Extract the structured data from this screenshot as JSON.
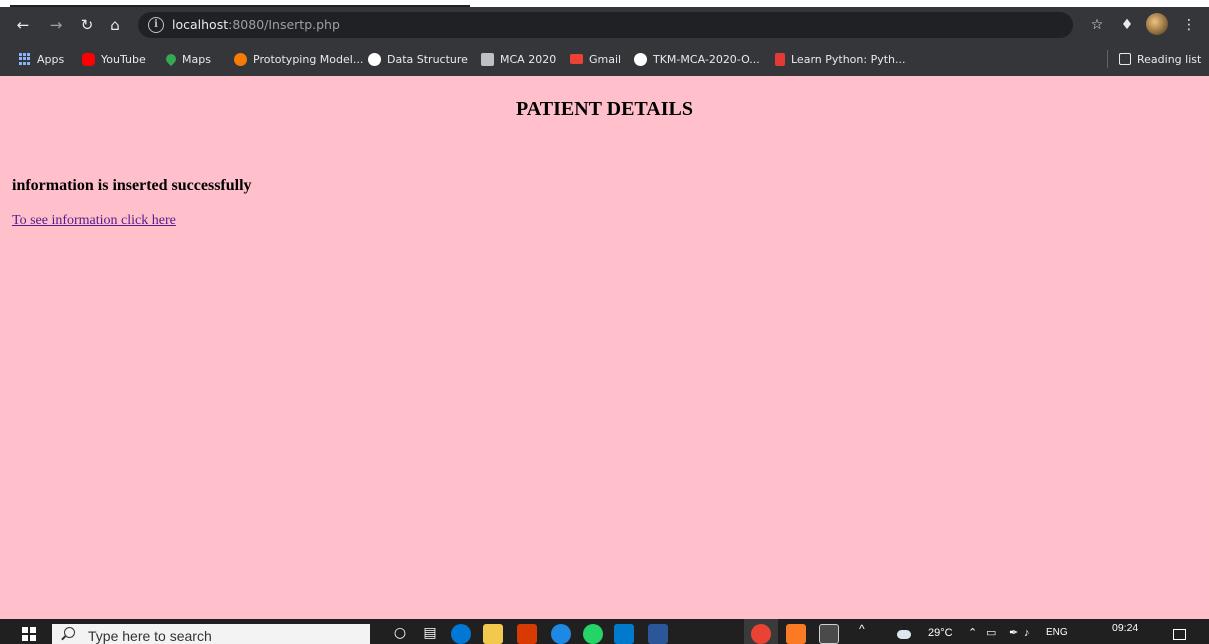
{
  "browser": {
    "url_host": "localhost",
    "url_rest": ":8080/Insertp.php",
    "nav": {
      "back_icon": "arrow-left-icon",
      "forward_icon": "arrow-right-icon",
      "reload_icon": "reload-icon",
      "home_icon": "home-icon"
    },
    "bookmarks": [
      {
        "label": "Apps",
        "icon": "apps-grid-icon",
        "color": "#8ab4f8"
      },
      {
        "label": "YouTube",
        "icon": "youtube-icon",
        "color": "#ff0000"
      },
      {
        "label": "Maps",
        "icon": "maps-pin-icon",
        "color": "#34a853"
      },
      {
        "label": "Prototyping Model...",
        "icon": "orange-circle-icon",
        "color": "#f57c00"
      },
      {
        "label": "Data Structure",
        "icon": "globe-icon",
        "color": "#ffffff"
      },
      {
        "label": "MCA 2020",
        "icon": "classroom-icon",
        "color": "#bdc1c6"
      },
      {
        "label": "Gmail",
        "icon": "gmail-icon",
        "color": "#ea4335"
      },
      {
        "label": "TKM-MCA-2020-O...",
        "icon": "github-icon",
        "color": "#ffffff"
      },
      {
        "label": "Learn Python: Pyth...",
        "icon": "codecademy-icon",
        "color": "#e53935"
      }
    ],
    "reading_list_label": "Reading list"
  },
  "page": {
    "title": "PATIENT DETAILS",
    "message": "information is inserted successfully",
    "link_text": "To see information click here",
    "background": "#ffc0cb"
  },
  "taskbar": {
    "search_placeholder": "Type here to search",
    "weather": "29°C",
    "language": "ENG",
    "time": "09:24"
  }
}
